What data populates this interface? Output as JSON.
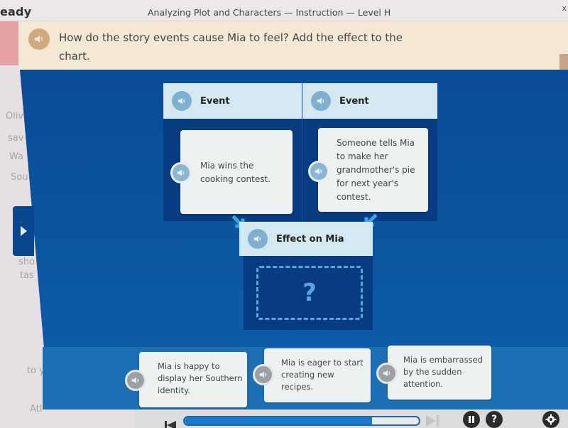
{
  "header": {
    "brand": "eady",
    "lesson_title": "Analyzing Plot and Characters — Instruction — Level H",
    "close_glyph": "x"
  },
  "story_panel": {
    "partial_lines": [
      "Oliv",
      "sav",
      "Wa",
      "Sou",
      "sho",
      "tas",
      "to y",
      "Atl"
    ]
  },
  "prompt": {
    "text": "How do the story events cause Mia to feel? Add the effect to the chart.",
    "audio_icon": "speaker-icon"
  },
  "chart": {
    "columns": [
      {
        "header": "Event",
        "card_text": "Mia wins the cooking contest."
      },
      {
        "header": "Event",
        "card_text": "Someone tells Mia to make her grandmother's pie for next year's contest."
      }
    ],
    "effect": {
      "header": "Effect on Mia",
      "placeholder": "?"
    }
  },
  "answer_choices": [
    {
      "text": "Mia is happy to display her Southern identity."
    },
    {
      "text": "Mia is eager to start creating new recipes."
    },
    {
      "text": "Mia is embarrassed by the sudden attention."
    }
  ],
  "controls": {
    "progress_fraction": 0.8,
    "pause_icon": "pause-icon",
    "help_label": "?",
    "settings_icon": "gear-icon"
  },
  "colors": {
    "stage_blue": "#0a4b98",
    "tray_blue": "#1d6fb3",
    "header_tile": "#d4e8f2",
    "accent_blue": "#5aa6dc",
    "prompt_bg": "#f4e8d4"
  }
}
